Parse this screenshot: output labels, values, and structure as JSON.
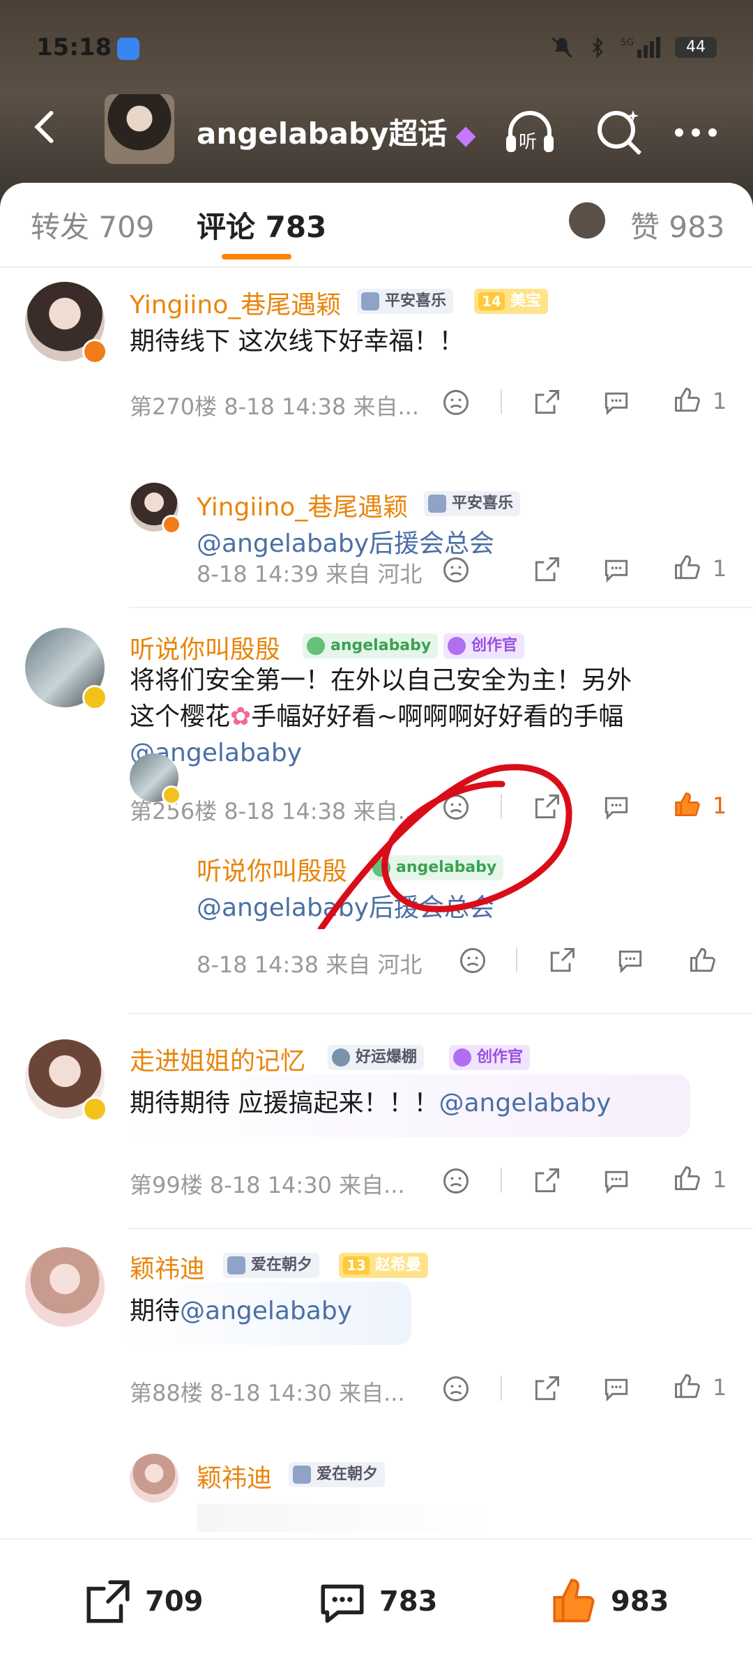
{
  "status": {
    "time": "15:18",
    "battery": "44"
  },
  "header": {
    "title": "angelababy超话"
  },
  "tabs": {
    "repost": "转发 709",
    "comments": "评论 783",
    "likes": "赞 983"
  },
  "comments": [
    {
      "name": "Yingiino_巷尾遇颖",
      "badge1": "平安喜乐",
      "badge2": "美宝",
      "badge2_level": "14",
      "text": "期待线下 这次线下好幸福！！",
      "meta": "第270楼 8-18 14:38 来自...",
      "likes": "1",
      "reply": {
        "name": "Yingiino_巷尾遇颖",
        "badge1": "平安喜乐",
        "text": "@angelababy后援会总会",
        "meta": "8-18 14:39 来自 河北",
        "likes": "1"
      }
    },
    {
      "name": "听说你叫殷殷",
      "badge1": "angelababy",
      "badge2": "创作官",
      "text_a": "将将们安全第一！在外以自己安全为主！另外",
      "text_b": "这个樱花",
      "text_c": "手幅好好看~啊啊啊好好看的手幅",
      "mention": "@angelababy",
      "meta": "第256楼 8-18 14:38 来自...",
      "likes": "1",
      "reply": {
        "name": "听说你叫殷殷",
        "badge1": "angelababy",
        "text": "@angelababy后援会总会",
        "meta": "8-18 14:38 来自 河北"
      }
    },
    {
      "name": "走进姐姐的记忆",
      "badge1": "好运爆棚",
      "badge2": "创作官",
      "text": "期待期待 应援搞起来！！！",
      "mention": "@angelababy",
      "meta": "第99楼 8-18 14:30 来自...",
      "likes": "1"
    },
    {
      "name": "颖祎迪",
      "badge1": "爱在朝夕",
      "badge2": "赵希曼",
      "badge2_level": "13",
      "text": "期待",
      "mention": "@angelababy",
      "meta": "第88楼 8-18 14:30 来自...",
      "likes": "1",
      "reply": {
        "name": "颖祎迪",
        "badge1": "爱在朝夕"
      }
    }
  ],
  "bottom": {
    "reposts": "709",
    "comments": "783",
    "likes": "983"
  },
  "colors": {
    "accent": "#ff8200",
    "username": "#e8850c",
    "annotation": "#d90d1a"
  }
}
